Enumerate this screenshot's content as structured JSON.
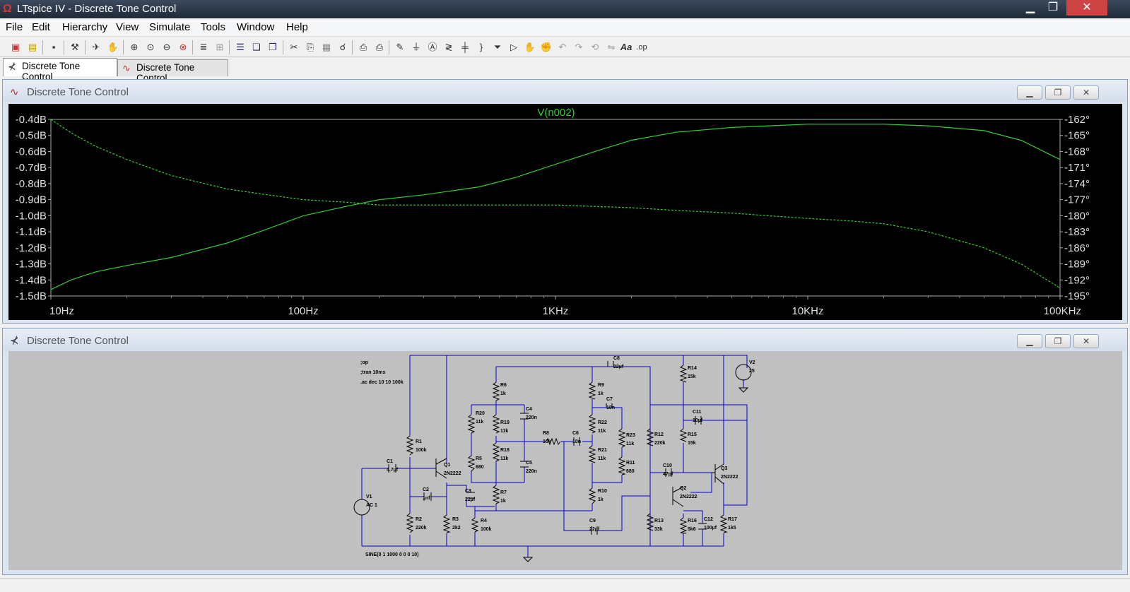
{
  "window": {
    "title": "LTspice IV - Discrete Tone Control",
    "min": "▁",
    "max": "❐",
    "close": "✕"
  },
  "menu": [
    "File",
    "Edit",
    "Hierarchy",
    "View",
    "Simulate",
    "Tools",
    "Window",
    "Help"
  ],
  "toolbar_icons": [
    "new-schematic-icon",
    "open-icon",
    "save-icon",
    "control-panel-icon",
    "run-icon",
    "halt-icon",
    "zoom-in-icon",
    "zoom-pan-icon",
    "zoom-out-icon",
    "zoom-cancel-icon",
    "autorange-icon",
    "grid-icon",
    "tile-horizontal-icon",
    "tile-vertical-icon",
    "cascade-icon",
    "cut-icon",
    "copy-icon",
    "paste-icon",
    "find-icon",
    "print-setup-icon",
    "print-icon",
    "wire-icon",
    "ground-icon",
    "label-icon",
    "resistor-icon",
    "capacitor-icon",
    "inductor-icon",
    "diode-icon",
    "component-icon",
    "move-icon",
    "drag-icon",
    "undo-icon",
    "redo-icon",
    "rotate-icon",
    "mirror-icon",
    "text-icon",
    "spice-directive-icon"
  ],
  "toolbar_text": {
    "text": "Aa",
    "op": ".op"
  },
  "tabs": [
    {
      "label": "Discrete Tone Control",
      "active": true
    },
    {
      "label": "Discrete Tone Control",
      "active": false
    }
  ],
  "plot_window": {
    "title": "Discrete Tone Control",
    "trace_label": "V(n002)",
    "trace_color": "#33cc33"
  },
  "schematic_window": {
    "title": "Discrete Tone Control"
  },
  "chart_data": {
    "type": "line",
    "title": "V(n002)",
    "xscale": "log",
    "xlim": [
      10,
      100000
    ],
    "x_ticks": [
      "10Hz",
      "100Hz",
      "1KHz",
      "10KHz",
      "100KHz"
    ],
    "y_left_ticks": [
      "-0.4dB",
      "-0.5dB",
      "-0.6dB",
      "-0.7dB",
      "-0.8dB",
      "-0.9dB",
      "-1.0dB",
      "-1.1dB",
      "-1.2dB",
      "-1.3dB",
      "-1.4dB",
      "-1.5dB"
    ],
    "y_right_ticks": [
      "-162°",
      "-165°",
      "-168°",
      "-171°",
      "-174°",
      "-177°",
      "-180°",
      "-183°",
      "-186°",
      "-189°",
      "-192°",
      "-195°"
    ],
    "ylim_left": [
      -1.5,
      -0.4
    ],
    "ylim_right": [
      -195,
      -162
    ],
    "series": [
      {
        "name": "V(n002)",
        "axis": "left",
        "style": "solid",
        "x": [
          10,
          12,
          15,
          20,
          30,
          50,
          70,
          100,
          150,
          200,
          300,
          500,
          700,
          1000,
          1500,
          2000,
          3000,
          5000,
          7000,
          10000,
          15000,
          20000,
          30000,
          50000,
          70000,
          100000
        ],
        "y": [
          -1.46,
          -1.4,
          -1.35,
          -1.31,
          -1.26,
          -1.17,
          -1.09,
          -1.0,
          -0.94,
          -0.9,
          -0.87,
          -0.82,
          -0.76,
          -0.68,
          -0.59,
          -0.53,
          -0.48,
          -0.45,
          -0.44,
          -0.43,
          -0.43,
          -0.43,
          -0.44,
          -0.47,
          -0.53,
          -0.65
        ]
      },
      {
        "name": "",
        "axis": "right",
        "style": "dashed",
        "x": [
          10,
          12,
          15,
          20,
          30,
          50,
          70,
          100,
          150,
          200,
          300,
          500,
          700,
          1000,
          1500,
          2000,
          3000,
          5000,
          7000,
          10000,
          15000,
          20000,
          30000,
          50000,
          70000,
          100000
        ],
        "y": [
          -162.0,
          -164.5,
          -167.0,
          -169.5,
          -172.5,
          -175.0,
          -176.0,
          -177.0,
          -177.5,
          -178.0,
          -178.0,
          -178.0,
          -178.0,
          -178.0,
          -178.3,
          -178.5,
          -179.0,
          -179.5,
          -180.0,
          -180.5,
          -181.0,
          -181.5,
          -183.0,
          -186.0,
          -189.0,
          -193.5
        ]
      }
    ]
  },
  "schematic": {
    "directives": [
      ";op",
      ";tran 10ms",
      ".ac dec 10 10 100k"
    ],
    "source_text": "SINE(0 1 1000 0 0 0 10)",
    "labels": [
      {
        "t": "R1",
        "s": "100k"
      },
      {
        "t": "R2",
        "s": "220k"
      },
      {
        "t": "C1",
        "s": "4.7µf"
      },
      {
        "t": "C2",
        "s": "1nf"
      },
      {
        "t": "Q1",
        "s": "2N2222"
      },
      {
        "t": "R3",
        "s": "2k2"
      },
      {
        "t": "C3",
        "s": "22µf"
      },
      {
        "t": "R4",
        "s": "100k"
      },
      {
        "t": "R6",
        "s": "1k"
      },
      {
        "t": "R20",
        "s": "11k"
      },
      {
        "t": "R19",
        "s": "11k"
      },
      {
        "t": "C4",
        "s": "220n"
      },
      {
        "t": "R5",
        "s": "680"
      },
      {
        "t": "R18",
        "s": "11k"
      },
      {
        "t": "C5",
        "s": "220n"
      },
      {
        "t": "R7",
        "s": "1k"
      },
      {
        "t": "R8",
        "s": "10k"
      },
      {
        "t": "C6",
        "s": "10n"
      },
      {
        "t": "R9",
        "s": "1k"
      },
      {
        "t": "C7",
        "s": "10n"
      },
      {
        "t": "R22",
        "s": "11k"
      },
      {
        "t": "R21",
        "s": "11k"
      },
      {
        "t": "R23",
        "s": "11k"
      },
      {
        "t": "R11",
        "s": "680"
      },
      {
        "t": "R10",
        "s": "1k"
      },
      {
        "t": "C8",
        "s": "22µf"
      },
      {
        "t": "C9",
        "s": "22µf"
      },
      {
        "t": "R12",
        "s": "220k"
      },
      {
        "t": "R13",
        "s": "33k"
      },
      {
        "t": "C10",
        "s": "47pf"
      },
      {
        "t": "Q2",
        "s": "2N2222"
      },
      {
        "t": "R14",
        "s": "15k"
      },
      {
        "t": "C11",
        "s": "10µf"
      },
      {
        "t": "R15",
        "s": "15k"
      },
      {
        "t": "R16",
        "s": "5k6"
      },
      {
        "t": "C12",
        "s": "100µf"
      },
      {
        "t": "Q3",
        "s": "2N2222"
      },
      {
        "t": "R17",
        "s": "1k5"
      },
      {
        "t": "V2",
        "s": "25"
      },
      {
        "t": "V1",
        "s": "AC 1"
      }
    ]
  }
}
